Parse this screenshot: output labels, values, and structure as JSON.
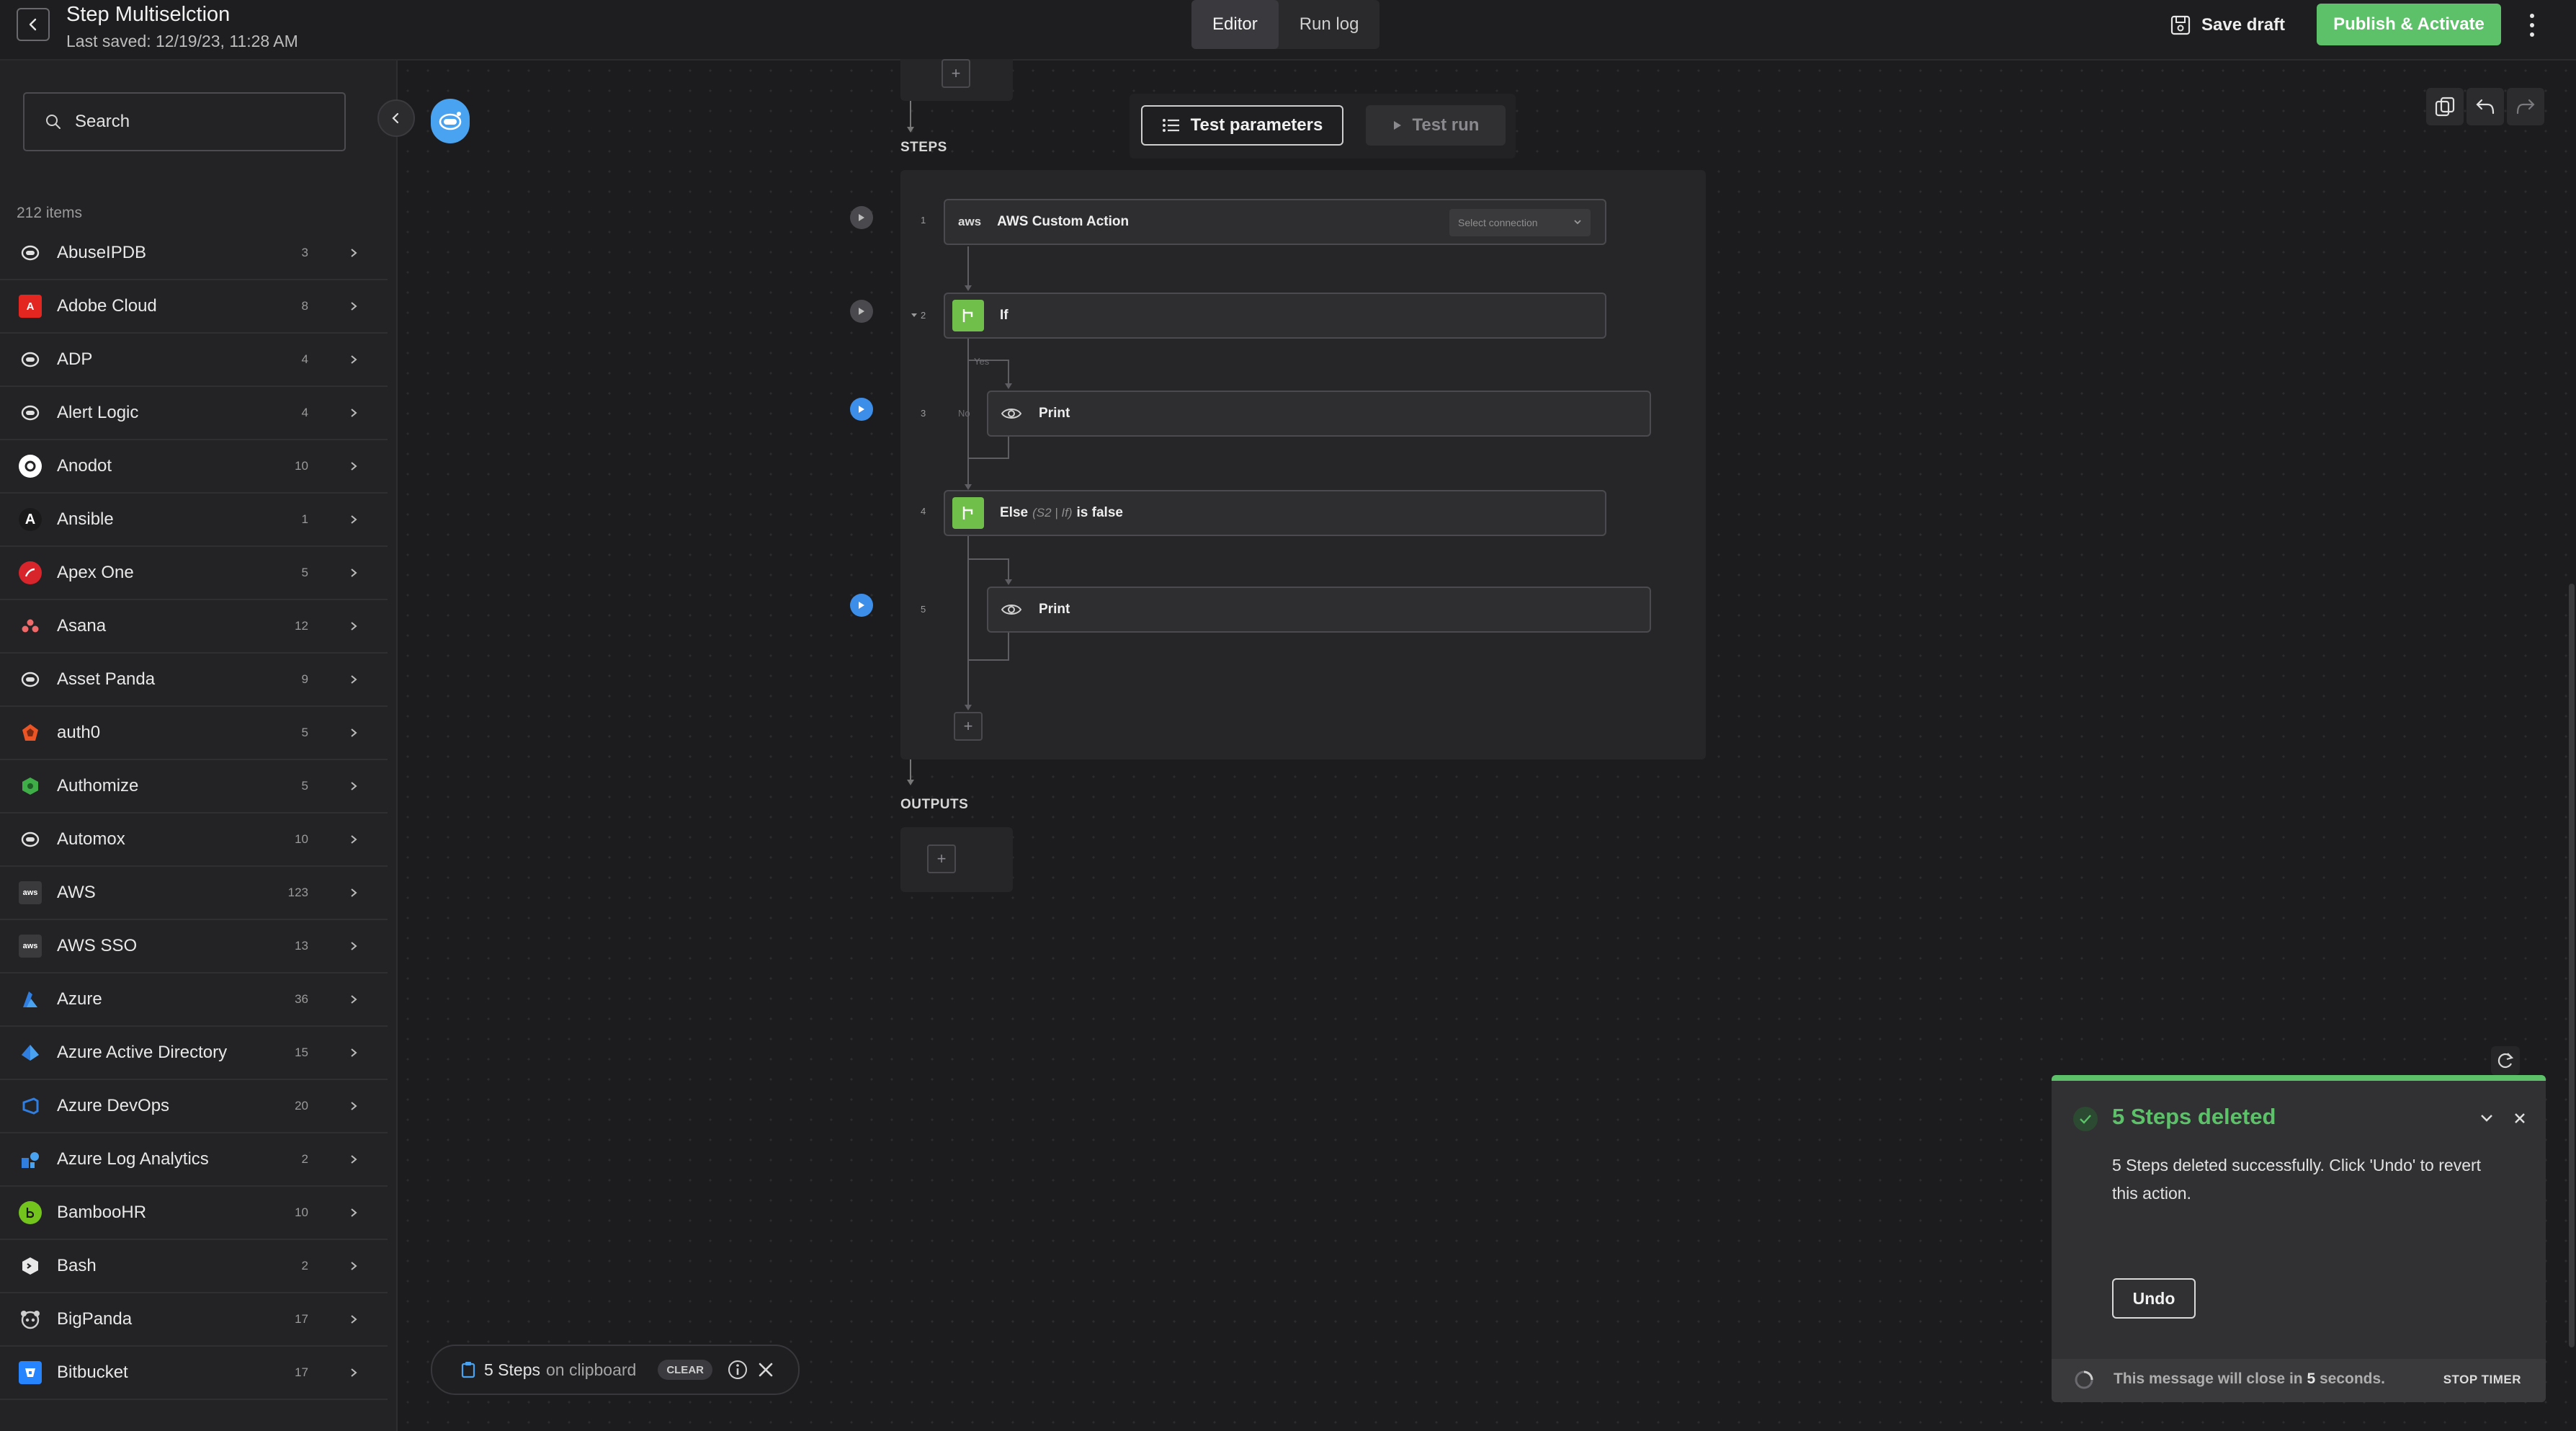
{
  "header": {
    "title": "Step Multiselction",
    "last_saved": "Last saved: 12/19/23, 11:28 AM",
    "tabs": [
      {
        "label": "Editor"
      },
      {
        "label": "Run log"
      }
    ],
    "save_draft": "Save draft",
    "publish": "Publish & Activate"
  },
  "sidebar": {
    "search_placeholder": "Search",
    "count": "212 items",
    "items": [
      {
        "label": "AbuseIPDB",
        "count": "3",
        "icon": "generic-connector-icon",
        "color": "#e0e0e0"
      },
      {
        "label": "Adobe Cloud",
        "count": "8",
        "icon": "adobe-icon",
        "color": "#e3261f"
      },
      {
        "label": "ADP",
        "count": "4",
        "icon": "generic-connector-icon",
        "color": "#e0e0e0"
      },
      {
        "label": "Alert Logic",
        "count": "4",
        "icon": "generic-connector-icon",
        "color": "#e0e0e0"
      },
      {
        "label": "Anodot",
        "count": "10",
        "icon": "anodot-icon",
        "color": "#ffffff"
      },
      {
        "label": "Ansible",
        "count": "1",
        "icon": "ansible-icon",
        "color": "#1a1a1a"
      },
      {
        "label": "Apex One",
        "count": "5",
        "icon": "apex-one-icon",
        "color": "#d8242b"
      },
      {
        "label": "Asana",
        "count": "12",
        "icon": "asana-icon",
        "color": "#f06a6a"
      },
      {
        "label": "Asset Panda",
        "count": "9",
        "icon": "generic-connector-icon",
        "color": "#e0e0e0"
      },
      {
        "label": "auth0",
        "count": "5",
        "icon": "auth0-icon",
        "color": "#eb5424"
      },
      {
        "label": "Authomize",
        "count": "5",
        "icon": "authomize-icon",
        "color": "#3fae49"
      },
      {
        "label": "Automox",
        "count": "10",
        "icon": "generic-connector-icon",
        "color": "#e0e0e0"
      },
      {
        "label": "AWS",
        "count": "123",
        "icon": "aws-icon",
        "color": "#3a3a3d"
      },
      {
        "label": "AWS SSO",
        "count": "13",
        "icon": "aws-icon",
        "color": "#3a3a3d"
      },
      {
        "label": "Azure",
        "count": "36",
        "icon": "azure-icon",
        "color": "#2f7ee0"
      },
      {
        "label": "Azure Active Directory",
        "count": "15",
        "icon": "azure-ad-icon",
        "color": "#4aa3f0"
      },
      {
        "label": "Azure DevOps",
        "count": "20",
        "icon": "azure-devops-icon",
        "color": "#2f7ee0"
      },
      {
        "label": "Azure Log Analytics",
        "count": "2",
        "icon": "azure-log-analytics-icon",
        "color": "#2f7ee0"
      },
      {
        "label": "BambooHR",
        "count": "10",
        "icon": "bamboohr-icon",
        "color": "#73c41d"
      },
      {
        "label": "Bash",
        "count": "2",
        "icon": "bash-icon",
        "color": "#e8e8e8"
      },
      {
        "label": "BigPanda",
        "count": "17",
        "icon": "bigpanda-icon",
        "color": "#cfcfcf"
      },
      {
        "label": "Bitbucket",
        "count": "17",
        "icon": "bitbucket-icon",
        "color": "#2684ff"
      }
    ]
  },
  "canvas": {
    "test_parameters": "Test parameters",
    "test_run": "Test run",
    "steps_label": "STEPS",
    "outputs_label": "OUTPUTS",
    "steps": [
      {
        "num": "1",
        "label": "AWS Custom Action",
        "logo": "aws",
        "select": "Select connection"
      },
      {
        "num": "2",
        "label": "If"
      },
      {
        "num": "3",
        "label": "Print",
        "branch_yes": "Yes",
        "branch_no": "No"
      },
      {
        "num": "4",
        "label": "Else",
        "label_muted": "(S2 | If)",
        "label_suffix": "is false"
      },
      {
        "num": "5",
        "label": "Print"
      }
    ]
  },
  "clipboard": {
    "count_text": "5 Steps",
    "suffix": "on clipboard",
    "clear": "CLEAR"
  },
  "toast": {
    "title": "5 Steps deleted",
    "message": "5 Steps deleted successfully. Click 'Undo' to revert this action.",
    "undo": "Undo",
    "footer_prefix": "This message will close in",
    "seconds": "5",
    "footer_suffix": "seconds.",
    "stop_timer": "STOP TIMER"
  },
  "colors": {
    "accent_green": "#5cc169",
    "accent_blue": "#4aa3f0",
    "step_green": "#6fbf4a"
  }
}
